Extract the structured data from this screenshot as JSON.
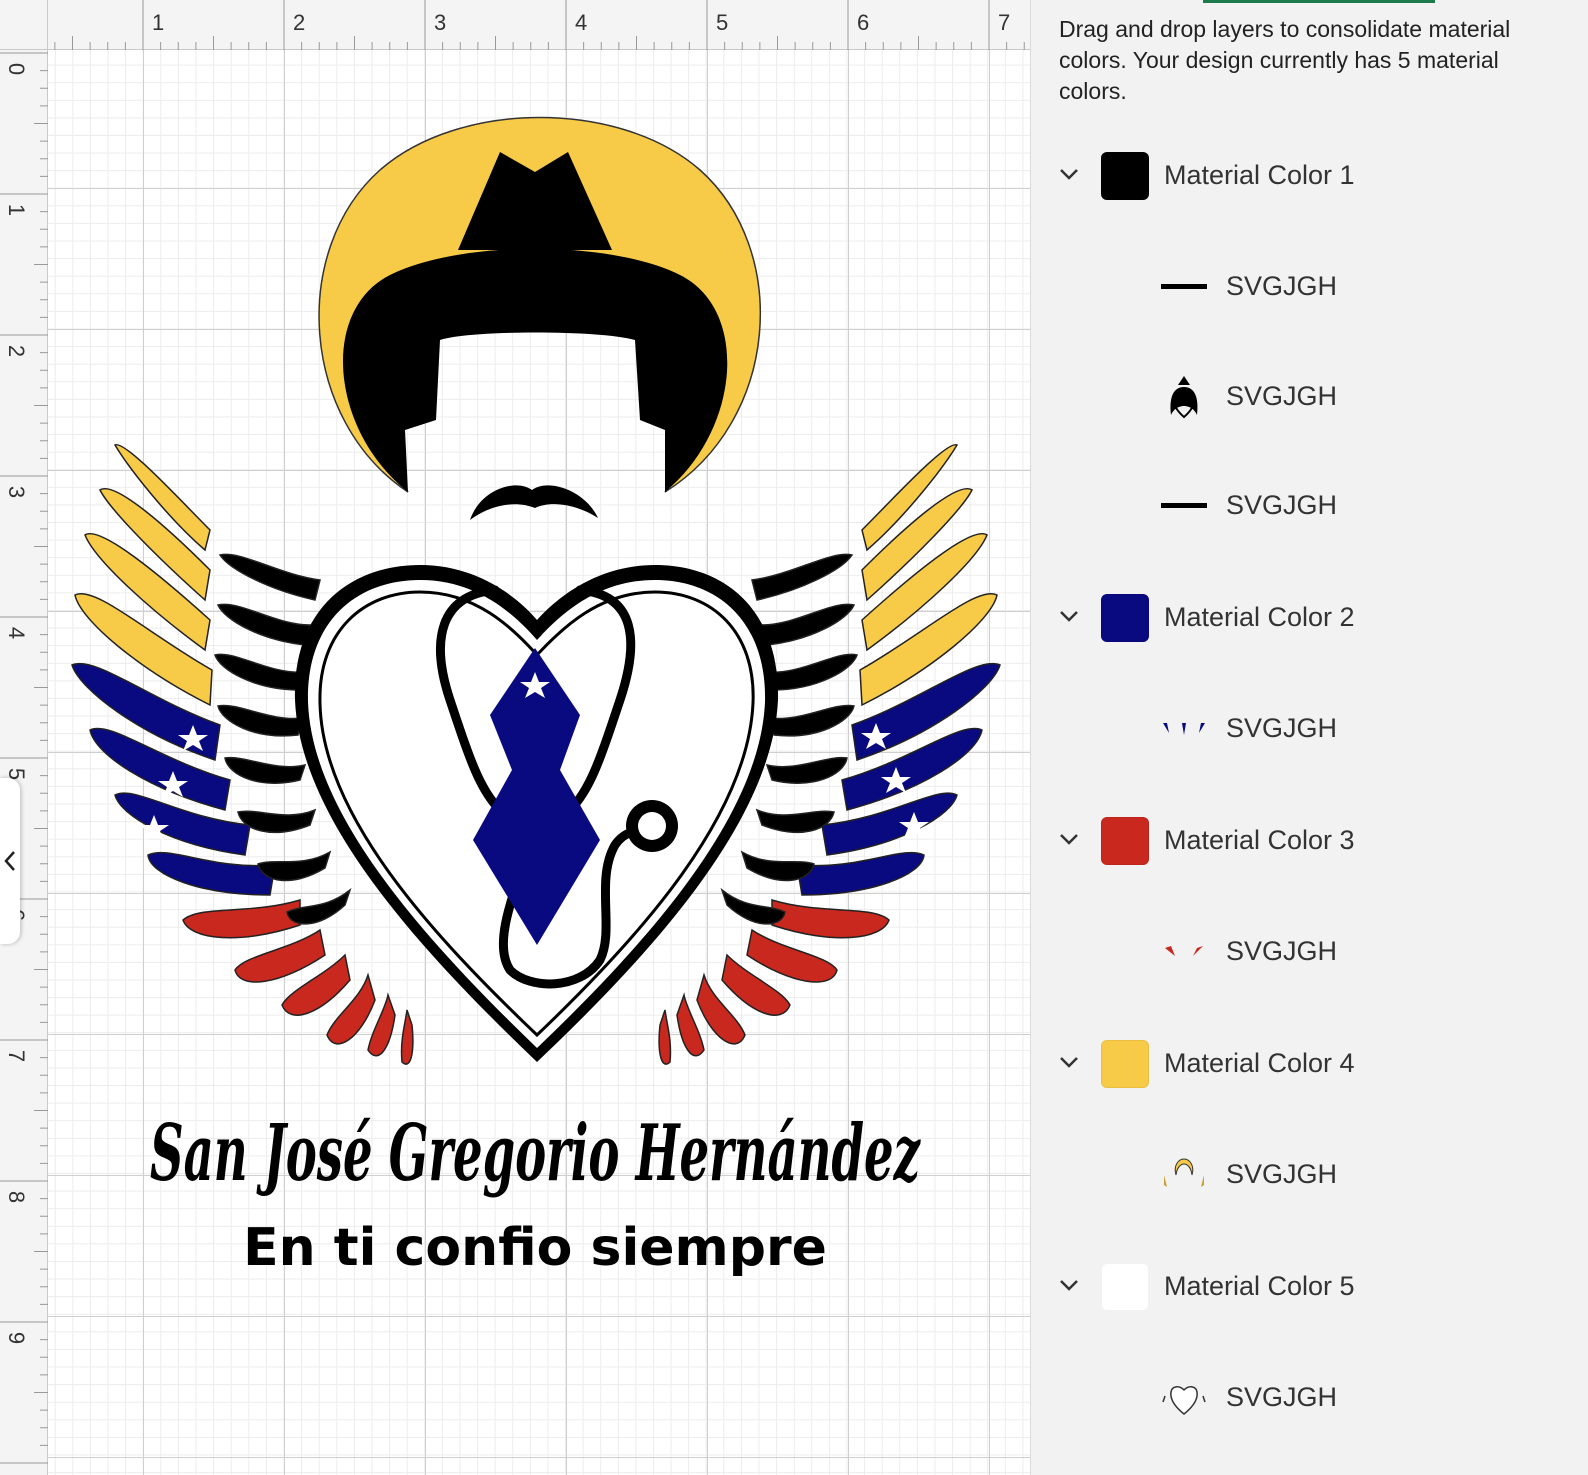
{
  "ruler": {
    "top_numbers": [
      "1",
      "2",
      "3",
      "4",
      "5",
      "6",
      "7"
    ],
    "left_numbers": [
      "0",
      "1",
      "2",
      "3",
      "4",
      "5",
      "6",
      "7",
      "8",
      "9"
    ]
  },
  "design": {
    "title_script": "San José Gregorio Hernández",
    "subtitle": "En ti confio siempre"
  },
  "panel": {
    "intro": "Drag and drop layers to consolidate material colors. Your design currently has 5 material colors.",
    "groups": [
      {
        "label": "Material Color 1",
        "color": "#000000",
        "layers": [
          {
            "label": "SVGJGH",
            "thumb": "text-strip-icon"
          },
          {
            "label": "SVGJGH",
            "thumb": "portrait-icon"
          },
          {
            "label": "SVGJGH",
            "thumb": "text-strip-icon"
          }
        ]
      },
      {
        "label": "Material Color 2",
        "color": "#0a0a80",
        "layers": [
          {
            "label": "SVGJGH",
            "thumb": "blue-wings-icon"
          }
        ]
      },
      {
        "label": "Material Color 3",
        "color": "#c8281e",
        "layers": [
          {
            "label": "SVGJGH",
            "thumb": "red-wings-icon"
          }
        ]
      },
      {
        "label": "Material Color 4",
        "color": "#f7cb48",
        "layers": [
          {
            "label": "SVGJGH",
            "thumb": "yellow-halo-icon"
          }
        ]
      },
      {
        "label": "Material Color 5",
        "color": "#ffffff",
        "layers": [
          {
            "label": "SVGJGH",
            "thumb": "white-heart-icon"
          }
        ]
      }
    ]
  },
  "colors": {
    "accent": "#1d7a4d",
    "black": "#000000",
    "blue": "#0a0a80",
    "red": "#c8281e",
    "yellow": "#f7cb48",
    "white": "#ffffff"
  }
}
